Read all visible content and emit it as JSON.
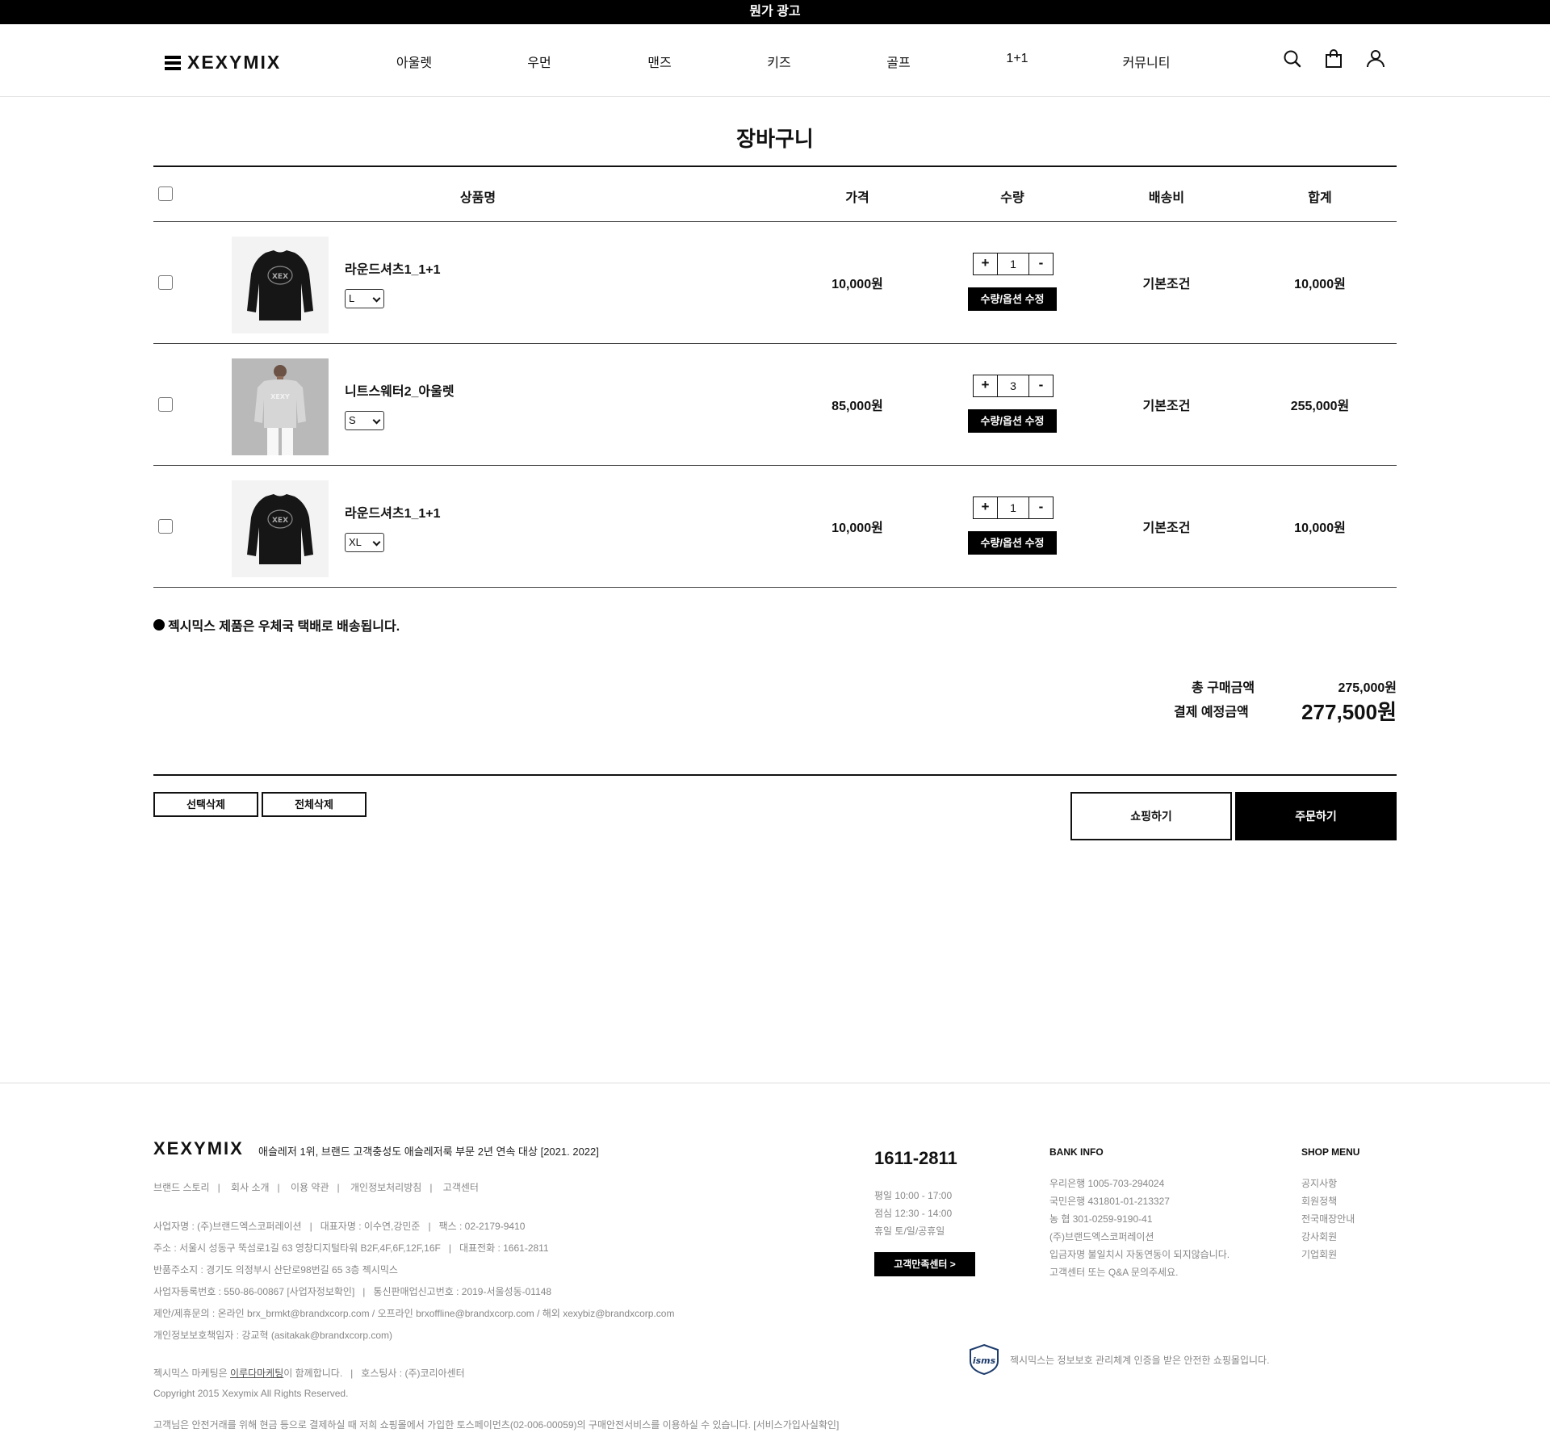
{
  "top_banner": "뭔가 광고",
  "header": {
    "logo": "XEXYMIX",
    "nav": [
      "아울렛",
      "우먼",
      "맨즈",
      "키즈",
      "골프",
      "1+1",
      "커뮤니티"
    ]
  },
  "page_title": "장바구니",
  "table": {
    "headers": [
      "상품명",
      "가격",
      "수량",
      "배송비",
      "합계"
    ],
    "edit_label": "수량/옵션 수정",
    "plus": "+",
    "minus": "-",
    "rows": [
      {
        "name": "라운드셔츠1_1+1",
        "option": "L",
        "price": "10,000원",
        "qty": "1",
        "shipping": "기본조건",
        "total": "10,000원"
      },
      {
        "name": "니트스웨터2_아울렛",
        "option": "S",
        "price": "85,000원",
        "qty": "3",
        "shipping": "기본조건",
        "total": "255,000원"
      },
      {
        "name": "라운드셔츠1_1+1",
        "option": "XL",
        "price": "10,000원",
        "qty": "1",
        "shipping": "기본조건",
        "total": "10,000원"
      }
    ]
  },
  "notice": "젝시믹스 제품은 우체국 택배로 배송됩니다.",
  "summary": {
    "total_label": "총 구매금액",
    "total_value": "275,000원",
    "pay_label": "결제 예정금액",
    "pay_value": "277,500원"
  },
  "buttons": {
    "delete_selected": "선택삭제",
    "delete_all": "전체삭제",
    "shopping": "쇼핑하기",
    "order": "주문하기"
  },
  "footer": {
    "logo": "XEXYMIX",
    "slogan": "애슬레저 1위, 브랜드 고객충성도 애슬레저룩 부문 2년 연속 대상 [2021. 2022]",
    "links": [
      "브랜드 스토리",
      "회사 소개",
      "이용 약관",
      "개인정보처리방침",
      "고객센터"
    ],
    "info": [
      "사업자명 : (주)브랜드엑스코퍼레이션   |   대표자명 : 이수연,강민준   |   팩스 : 02-2179-9410",
      "주소 : 서울시 성동구 뚝섬로1길 63 영창디지털타워 B2F,4F,6F,12F,16F   |   대표전화 : 1661-2811",
      "반품주소지 : 경기도 의정부시 산단로98번길 65 3층 젝시믹스",
      "사업자등록번호 : 550-86-00867 [사업자정보확인]   |   통신판매업신고번호 : 2019-서울성동-01148",
      "제안/제휴문의 : 온라인 brx_brmkt@brandxcorp.com / 오프라인 brxoffline@brandxcorp.com / 해외 xexybiz@brandxcorp.com",
      "개인정보보호책임자 : 강교혁 (asitakak@brandxcorp.com)"
    ],
    "marketing_prefix": "젝시믹스 마케팅은 ",
    "marketing_link": "이루다마케팅",
    "marketing_suffix": "이 함께합니다.   |   호스팅사 : (주)코리아센터",
    "copyright": "Copyright 2015 Xexymix All Rights Reserved.",
    "escrow": "고객님은 안전거래를 위해 현금 등으로 결제하실 때 저희 쇼핑몰에서 가입한 토스페이먼츠(02-006-00059)의 구매안전서비스를 이용하실 수 있습니다. [서비스가입사실확인]",
    "phone": "1611-2811",
    "hours": [
      "평일 10:00 - 17:00",
      "점심 12:30 - 14:00",
      "휴일 토/일/공휴일"
    ],
    "cs_button": "고객만족센터 >",
    "bank_title": "BANK INFO",
    "bank_lines": [
      "우리은행 1005-703-294024",
      "국민은행 431801-01-213327",
      "농 협 301-0259-9190-41",
      "(주)브랜드엑스코퍼레이션",
      "입금자명 불일치시 자동연동이 되지않습니다.",
      "고객센터 또는 Q&A 문의주세요."
    ],
    "shop_title": "SHOP MENU",
    "shop_items": [
      "공지사항",
      "회원정책",
      "전국매장안내",
      "강사회원",
      "기업회원"
    ],
    "isms_label": "isms",
    "isms_text": "젝시믹스는 정보보호 관리체계 인증을 받은 안전한 쇼핑몰입니다."
  }
}
